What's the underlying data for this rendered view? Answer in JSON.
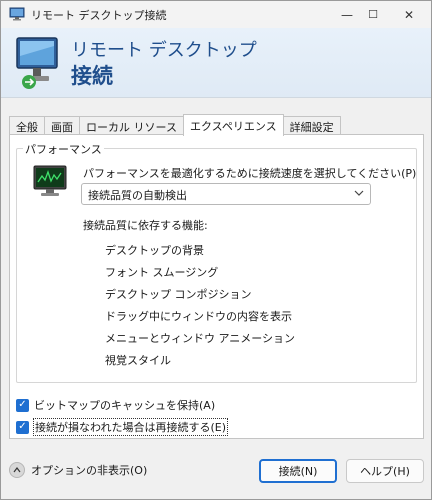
{
  "window": {
    "title": "リモート デスクトップ接続",
    "minimize_glyph": "—",
    "maximize_glyph": "☐",
    "close_glyph": "✕"
  },
  "banner": {
    "line1": "リモート デスクトップ",
    "line2": "接続"
  },
  "tabs": [
    {
      "label": "全般",
      "active": false
    },
    {
      "label": "画面",
      "active": false
    },
    {
      "label": "ローカル リソース",
      "active": false
    },
    {
      "label": "エクスペリエンス",
      "active": true
    },
    {
      "label": "詳細設定",
      "active": false
    }
  ],
  "performance": {
    "group_label": "パフォーマンス",
    "description": "パフォーマンスを最適化するために接続速度を選択してください(P)",
    "selected_option": "接続品質の自動検出",
    "features_heading": "接続品質に依存する機能:",
    "features": [
      "デスクトップの背景",
      "フォント スムージング",
      "デスクトップ コンポジション",
      "ドラッグ中にウィンドウの内容を表示",
      "メニューとウィンドウ アニメーション",
      "視覚スタイル"
    ]
  },
  "checkboxes": [
    {
      "label": "ビットマップのキャッシュを保持(A)",
      "checked": true
    },
    {
      "label": "接続が損なわれた場合は再接続する(E)",
      "checked": true
    }
  ],
  "footer": {
    "options_toggle": "オプションの非表示(O)",
    "connect_button": "接続(N)",
    "help_button": "ヘルプ(H)"
  },
  "colors": {
    "accent": "#1f6fd1",
    "banner_text": "#1f4e8c"
  },
  "icons": {
    "app": "remote-desktop-icon",
    "banner": "remote-desktop-monitor-icon",
    "performance": "performance-monitor-icon",
    "dropdown": "chevron-down-icon",
    "options_toggle": "chevron-up-icon"
  }
}
